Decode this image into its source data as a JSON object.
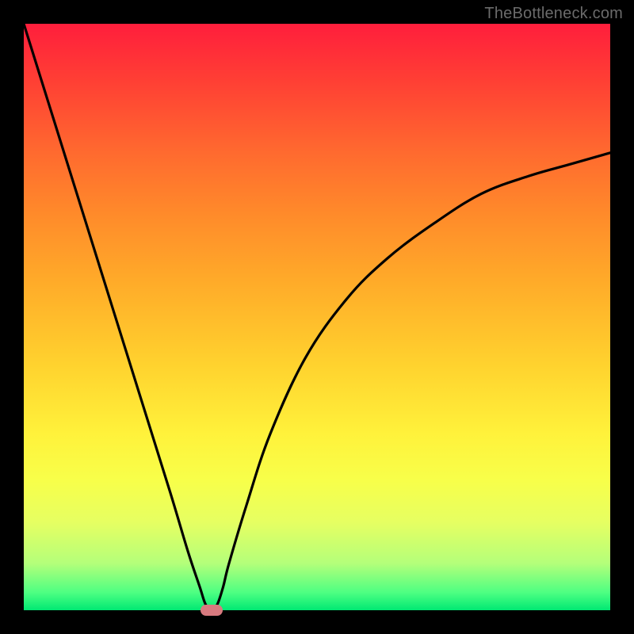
{
  "watermark": "TheBottleneck.com",
  "chart_data": {
    "type": "line",
    "title": "",
    "xlabel": "",
    "ylabel": "",
    "xlim": [
      0,
      100
    ],
    "ylim": [
      0,
      100
    ],
    "grid": false,
    "legend": false,
    "series": [
      {
        "name": "curve",
        "color": "#000000",
        "x": [
          0,
          5,
          10,
          15,
          20,
          25,
          28,
          30,
          31,
          32,
          33,
          34,
          35,
          38,
          42,
          48,
          55,
          62,
          70,
          78,
          86,
          93,
          100
        ],
        "y": [
          100,
          84,
          68,
          52,
          36,
          20,
          10,
          4,
          1,
          0,
          1,
          4,
          8,
          18,
          30,
          43,
          53,
          60,
          66,
          71,
          74,
          76,
          78
        ]
      }
    ],
    "marker": {
      "x": 32,
      "y": 0,
      "color": "#d87a7f"
    },
    "background_gradient_note": "vertical gradient red → orange → yellow → green inside black frame"
  }
}
